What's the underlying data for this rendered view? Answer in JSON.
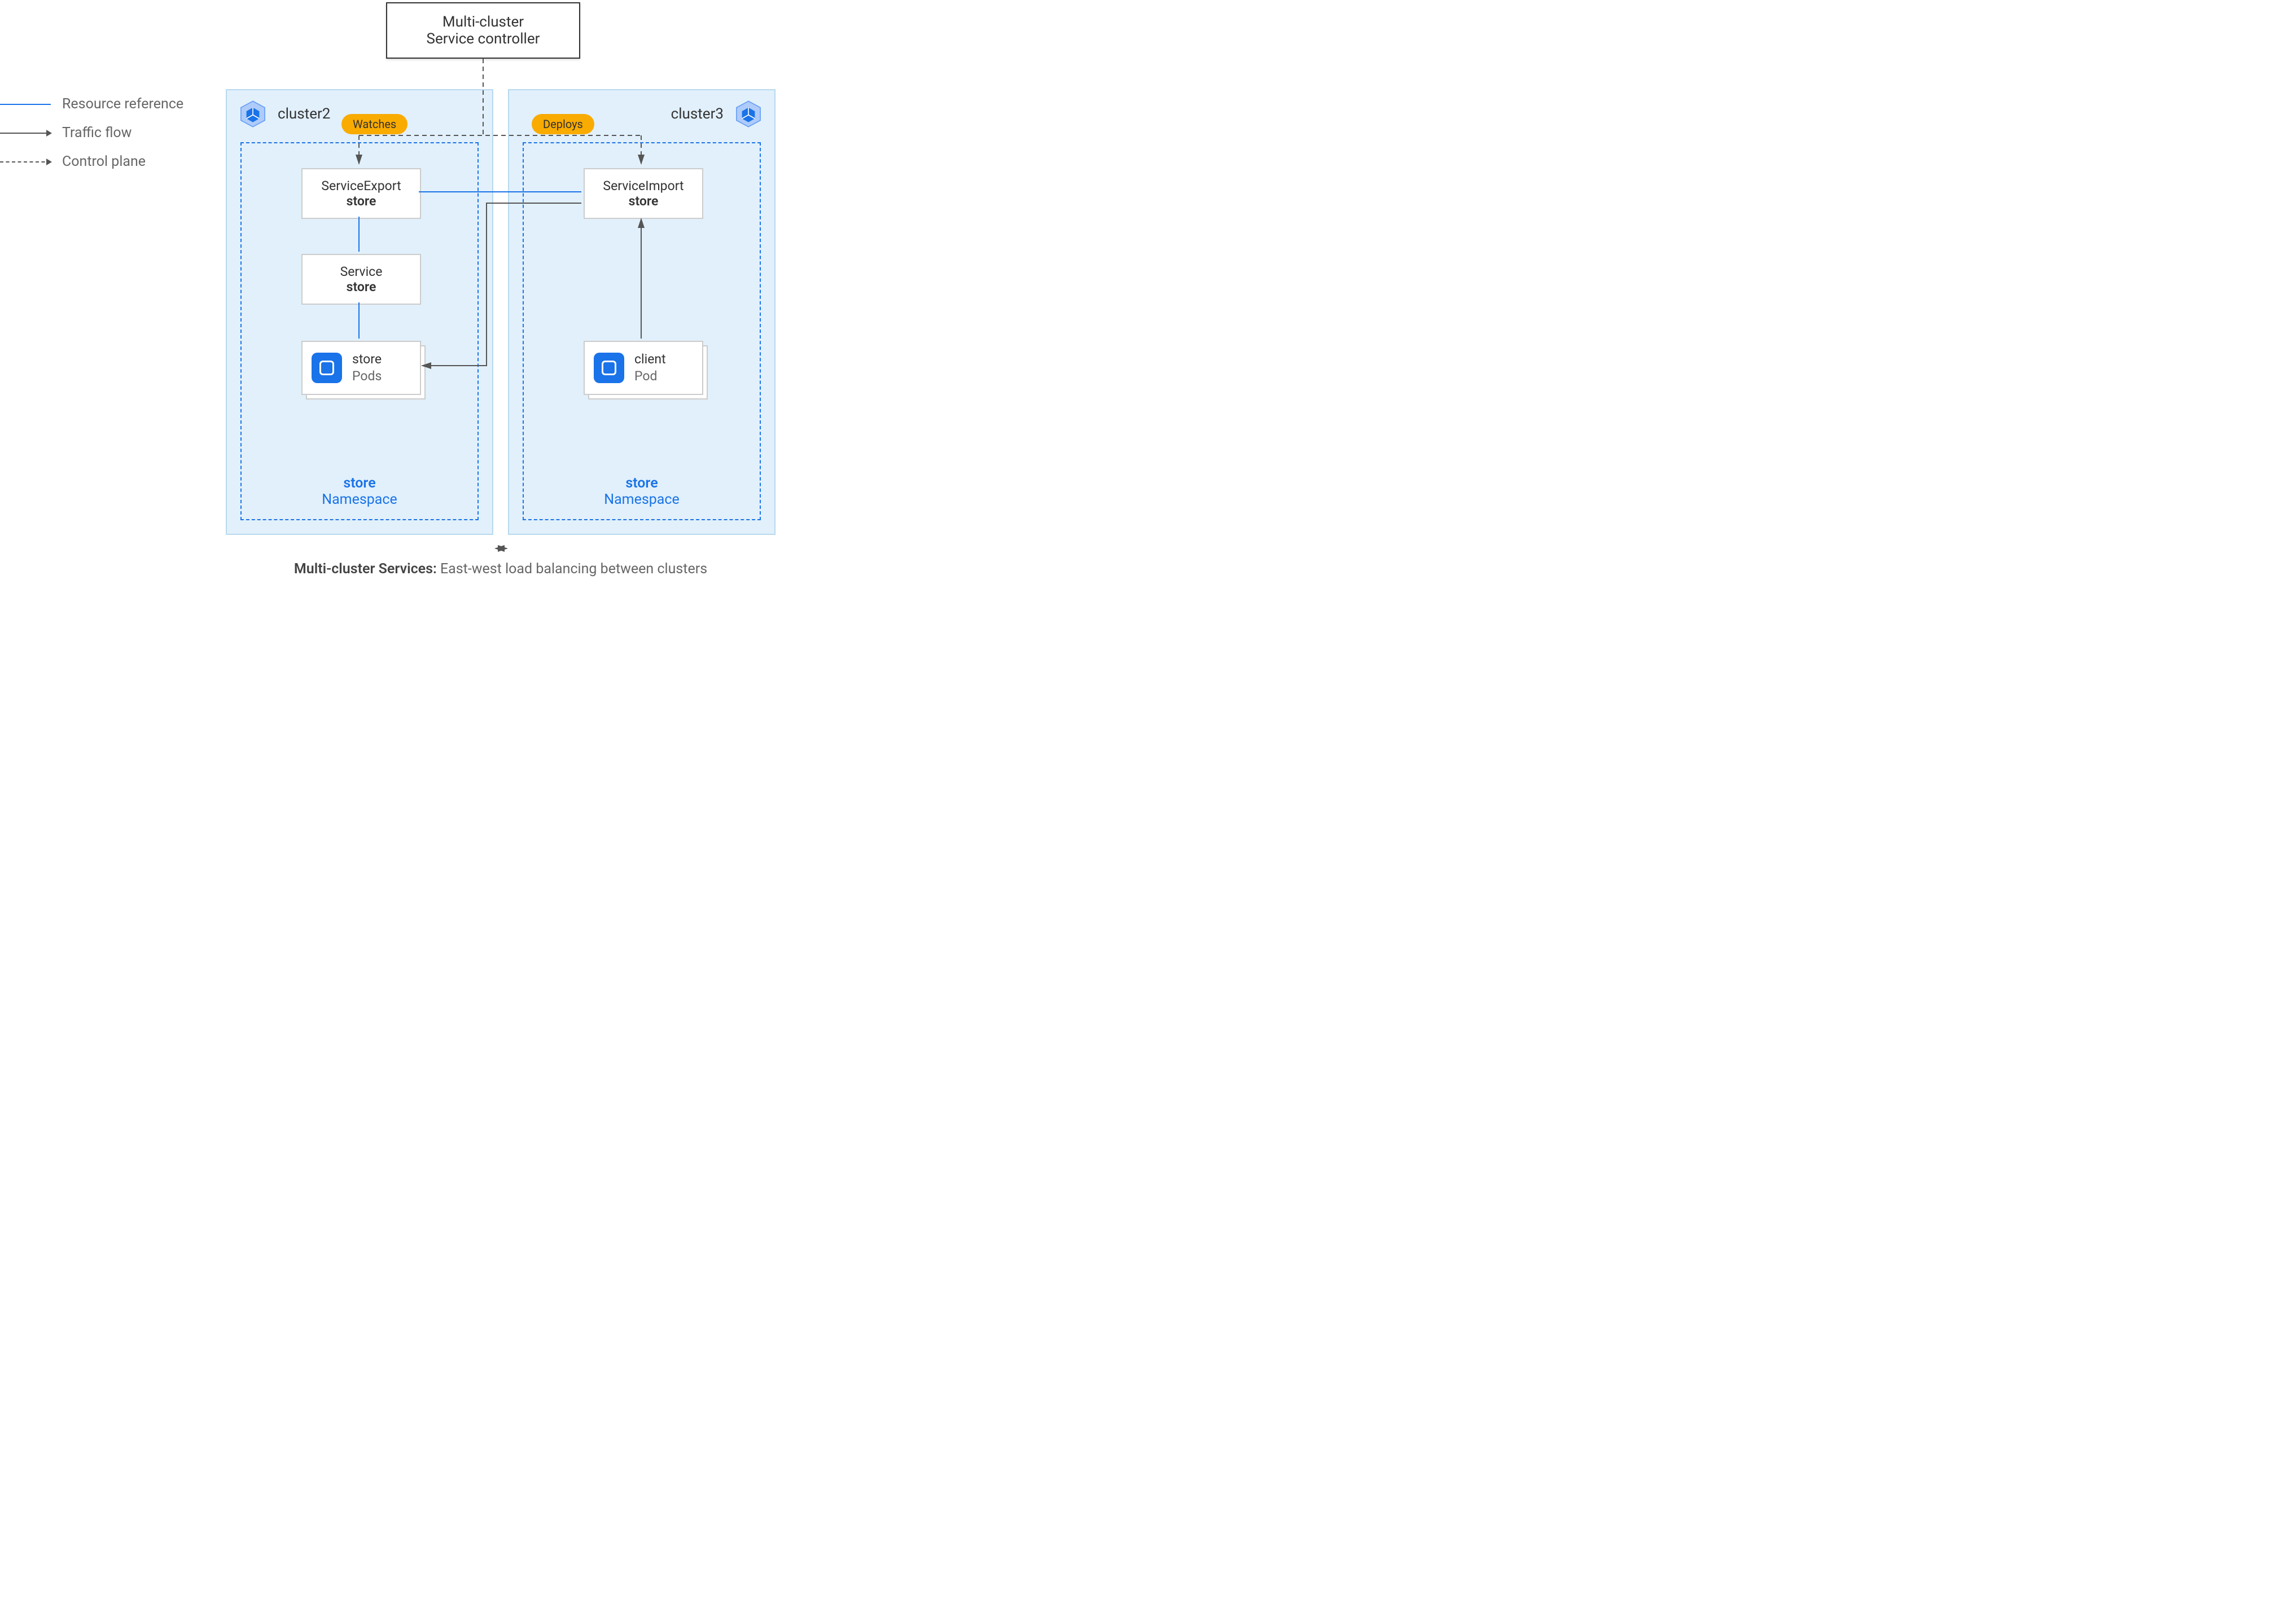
{
  "controller": {
    "line1": "Multi-cluster",
    "line2": "Service controller"
  },
  "legend": {
    "resource_reference": "Resource reference",
    "traffic_flow": "Traffic flow",
    "control_plane": "Control plane"
  },
  "badges": {
    "watches": "Watches",
    "deploys": "Deploys"
  },
  "cluster2": {
    "name": "cluster2",
    "namespace": {
      "name": "store",
      "label": "Namespace",
      "service_export": {
        "type": "ServiceExport",
        "name": "store"
      },
      "service": {
        "type": "Service",
        "name": "store"
      },
      "pods": {
        "name": "store",
        "label": "Pods"
      }
    }
  },
  "cluster3": {
    "name": "cluster3",
    "namespace": {
      "name": "store",
      "label": "Namespace",
      "service_import": {
        "type": "ServiceImport",
        "name": "store"
      },
      "pod": {
        "name": "client",
        "label": "Pod"
      }
    }
  },
  "caption": {
    "bold": "Multi-cluster Services:",
    "rest": " East-west load balancing between clusters"
  },
  "colors": {
    "cluster_bg": "#e1f0fb",
    "cluster_border": "#b8d9ee",
    "accent_blue": "#1a73e8",
    "badge_bg": "#f9ab00",
    "text_dark": "#333333",
    "text_muted": "#666666"
  }
}
